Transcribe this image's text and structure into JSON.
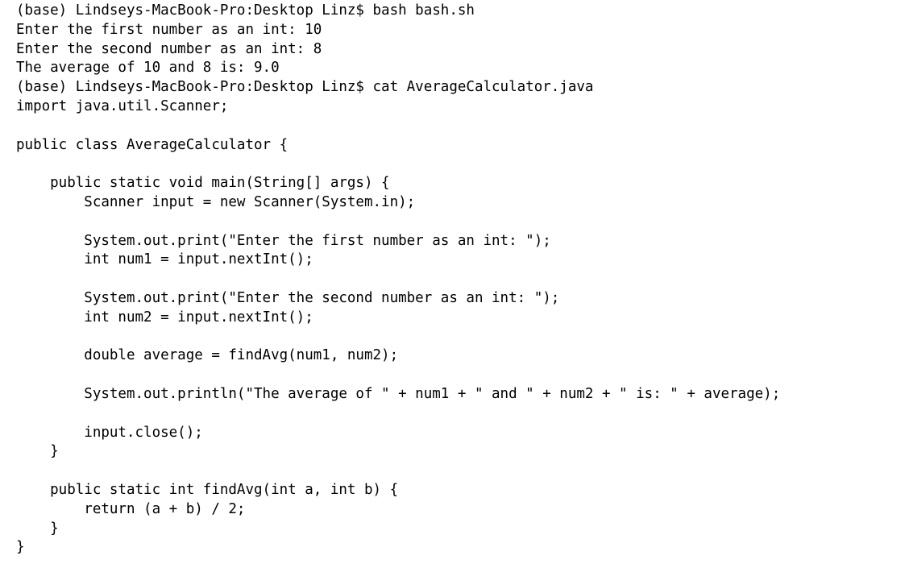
{
  "terminal": {
    "lines": [
      "(base) Lindseys-MacBook-Pro:Desktop Linz$ bash bash.sh",
      "Enter the first number as an int: 10",
      "Enter the second number as an int: 8",
      "The average of 10 and 8 is: 9.0",
      "(base) Lindseys-MacBook-Pro:Desktop Linz$ cat AverageCalculator.java",
      "import java.util.Scanner;",
      "",
      "public class AverageCalculator {",
      "",
      "    public static void main(String[] args) {",
      "        Scanner input = new Scanner(System.in);",
      "",
      "        System.out.print(\"Enter the first number as an int: \");",
      "        int num1 = input.nextInt();",
      "",
      "        System.out.print(\"Enter the second number as an int: \");",
      "        int num2 = input.nextInt();",
      "",
      "        double average = findAvg(num1, num2);",
      "",
      "        System.out.println(\"The average of \" + num1 + \" and \" + num2 + \" is: \" + average);",
      "",
      "        input.close();",
      "    }",
      "",
      "    public static int findAvg(int a, int b) {",
      "        return (a + b) / 2;",
      "    }",
      "}"
    ]
  }
}
